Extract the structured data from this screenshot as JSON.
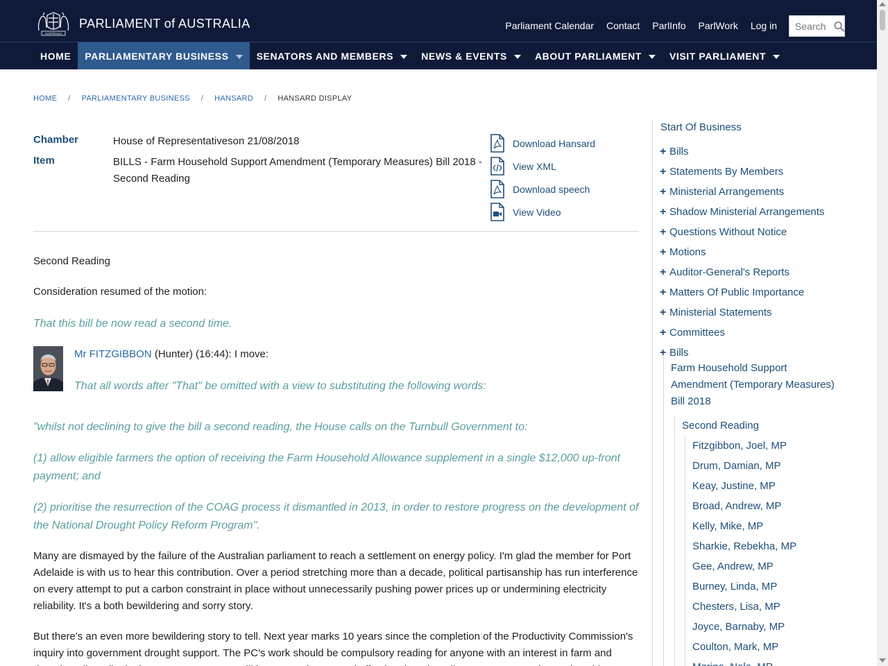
{
  "header": {
    "logo_text": "PARLIAMENT of AUSTRALIA",
    "logo_crest_text": "AUSTRALIA",
    "top_links": [
      "Parliament Calendar",
      "Contact",
      "ParlInfo",
      "ParlWork",
      "Log in"
    ],
    "search_placeholder": "Search"
  },
  "nav": {
    "items": [
      {
        "label": "HOME",
        "dropdown": false,
        "active": false
      },
      {
        "label": "PARLIAMENTARY BUSINESS",
        "dropdown": true,
        "active": true
      },
      {
        "label": "SENATORS AND MEMBERS",
        "dropdown": true,
        "active": false
      },
      {
        "label": "NEWS & EVENTS",
        "dropdown": true,
        "active": false
      },
      {
        "label": "ABOUT PARLIAMENT",
        "dropdown": true,
        "active": false
      },
      {
        "label": "VISIT PARLIAMENT",
        "dropdown": true,
        "active": false
      }
    ]
  },
  "breadcrumb": {
    "items": [
      "HOME",
      "PARLIAMENTARY BUSINESS",
      "HANSARD"
    ],
    "current": "HANSARD DISPLAY",
    "separator": "/"
  },
  "meta": {
    "chamber_label": "Chamber",
    "chamber_value": "House of Representativeson 21/08/2018",
    "item_label": "Item",
    "item_value": "BILLS - Farm Household Support Amendment (Temporary Measures) Bill 2018 - Second Reading"
  },
  "downloads": [
    {
      "label": "Download Hansard",
      "icon": "pdf-icon"
    },
    {
      "label": "View XML",
      "icon": "xml-icon"
    },
    {
      "label": "Download speech",
      "icon": "pdf-icon"
    },
    {
      "label": "View Video",
      "icon": "video-icon"
    }
  ],
  "content": {
    "heading": "Second Reading",
    "intro": "Consideration resumed of the motion:",
    "motion": "That this bill be now read a second time.",
    "speaker_name": "Mr FITZGIBBON",
    "speaker_rest": " (Hunter) (16:44): I move:",
    "amendment_1": "That all words after \"That\" be omitted with a view to substituting the following words:",
    "amendment_2": "\"whilst not declining to give the bill a second reading, the House calls on the Turnbull Government to:",
    "amendment_3": "(1) allow eligible farmers the option of receiving the Farm Household Allowance supplement in a single $12,000 up-front payment; and",
    "amendment_4": "(2) prioritise the resurrection of the COAG process it dismantled in 2013, in order to restore progress on the development of the National Drought Policy Reform Program\".",
    "para_1": "Many are dismayed by the failure of the Australian parliament to reach a settlement on energy policy. I'm glad the member for Port Adelaide is with us to hear this contribution. Over a period stretching more than a decade, political partisanship has run interference on every attempt to put a carbon constraint in place without unnecessarily pushing power prices up or undermining electricity reliability. It's a both bewildering and sorry story.",
    "para_2": "But there's an even more bewildering story to tell. Next year marks 10 years since the completion of the Productivity Commission's inquiry into government drought support. The PC's work should be compulsory reading for anyone with an interest in farm and drought policy. Like in the energy sector, we still have no coherent and effective drought policy 10 years on. What makes this even"
  },
  "sidebar": {
    "start": "Start Of Business",
    "sections": [
      "Bills",
      "Statements By Members",
      "Ministerial Arrangements",
      "Shadow Ministerial Arrangements",
      "Questions Without Notice",
      "Motions",
      "Auditor-General's Reports",
      "Matters Of Public Importance",
      "Ministerial Statements",
      "Committees",
      "Bills"
    ],
    "bill_title": "Farm Household Support Amendment (Temporary Measures) Bill 2018",
    "second_reading": "Second Reading",
    "members": [
      "Fitzgibbon, Joel, MP",
      "Drum, Damian, MP",
      "Keay, Justine, MP",
      "Broad, Andrew, MP",
      "Kelly, Mike, MP",
      "Sharkie, Rebekha, MP",
      "Gee, Andrew, MP",
      "Burney, Linda, MP",
      "Chesters, Lisa, MP",
      "Joyce, Barnaby, MP",
      "Coulton, Mark, MP",
      "Marino, Nola, MP"
    ]
  }
}
